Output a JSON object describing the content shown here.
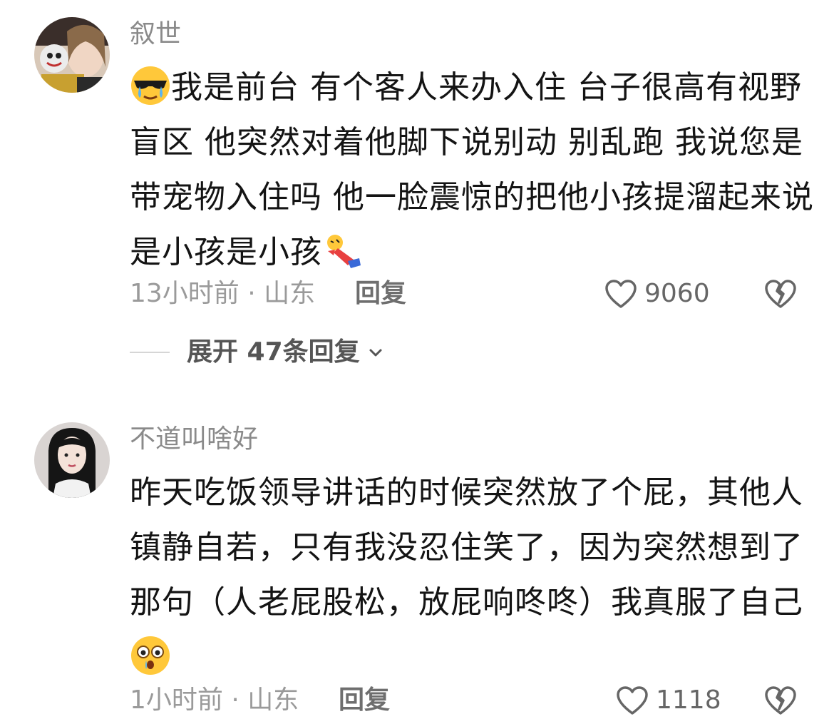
{
  "comments": [
    {
      "username": "叙世",
      "lines": [
        "我是前台 有个客人来办入住 台子很高有视野",
        "盲区 他突然对着他脚下说别动 别乱跑 我说您是",
        "带宠物入住吗 他一脸震惊的把他小孩提溜起来说",
        "是小孩是小孩"
      ],
      "leading_emoji": "sunglasses-tears-emoji",
      "trailing_emoji": "falling-person-emoji",
      "meta": "13小时前 · 山东",
      "reply_label": "回复",
      "like_count": "9060",
      "expand_label": "展开 47条回复"
    },
    {
      "username": "不道叫啥好",
      "lines": [
        "昨天吃饭领导讲话的时候突然放了个屁，其他人",
        "镇静自若，只有我没忍住笑了，因为突然想到了",
        "那句（人老屁股松，放屁响咚咚）我真服了自己",
        ""
      ],
      "trailing_emoji": "astonished-face-emoji",
      "meta": "1小时前 · 山东",
      "reply_label": "回复",
      "like_count": "1118"
    }
  ],
  "colors": {
    "username": "#8a8a8a",
    "text": "#141414",
    "meta": "#9a9a9a"
  },
  "icons": [
    "heart-outline-icon",
    "broken-heart-icon",
    "chevron-down-icon"
  ]
}
